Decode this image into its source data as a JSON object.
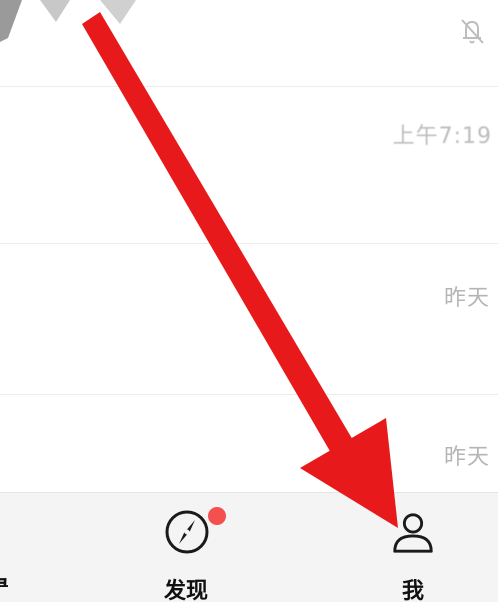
{
  "chat_list": {
    "rows": [
      {
        "time": "上午7:19"
      },
      {
        "time": "昨天"
      },
      {
        "time": "昨天"
      }
    ]
  },
  "tab_bar": {
    "contacts_partial_label": "录",
    "discover_label": "发现",
    "me_label": "我"
  },
  "colors": {
    "arrow": "#e8191b",
    "badge": "#f45050",
    "tab_bar_bg": "#f4f4f4"
  }
}
